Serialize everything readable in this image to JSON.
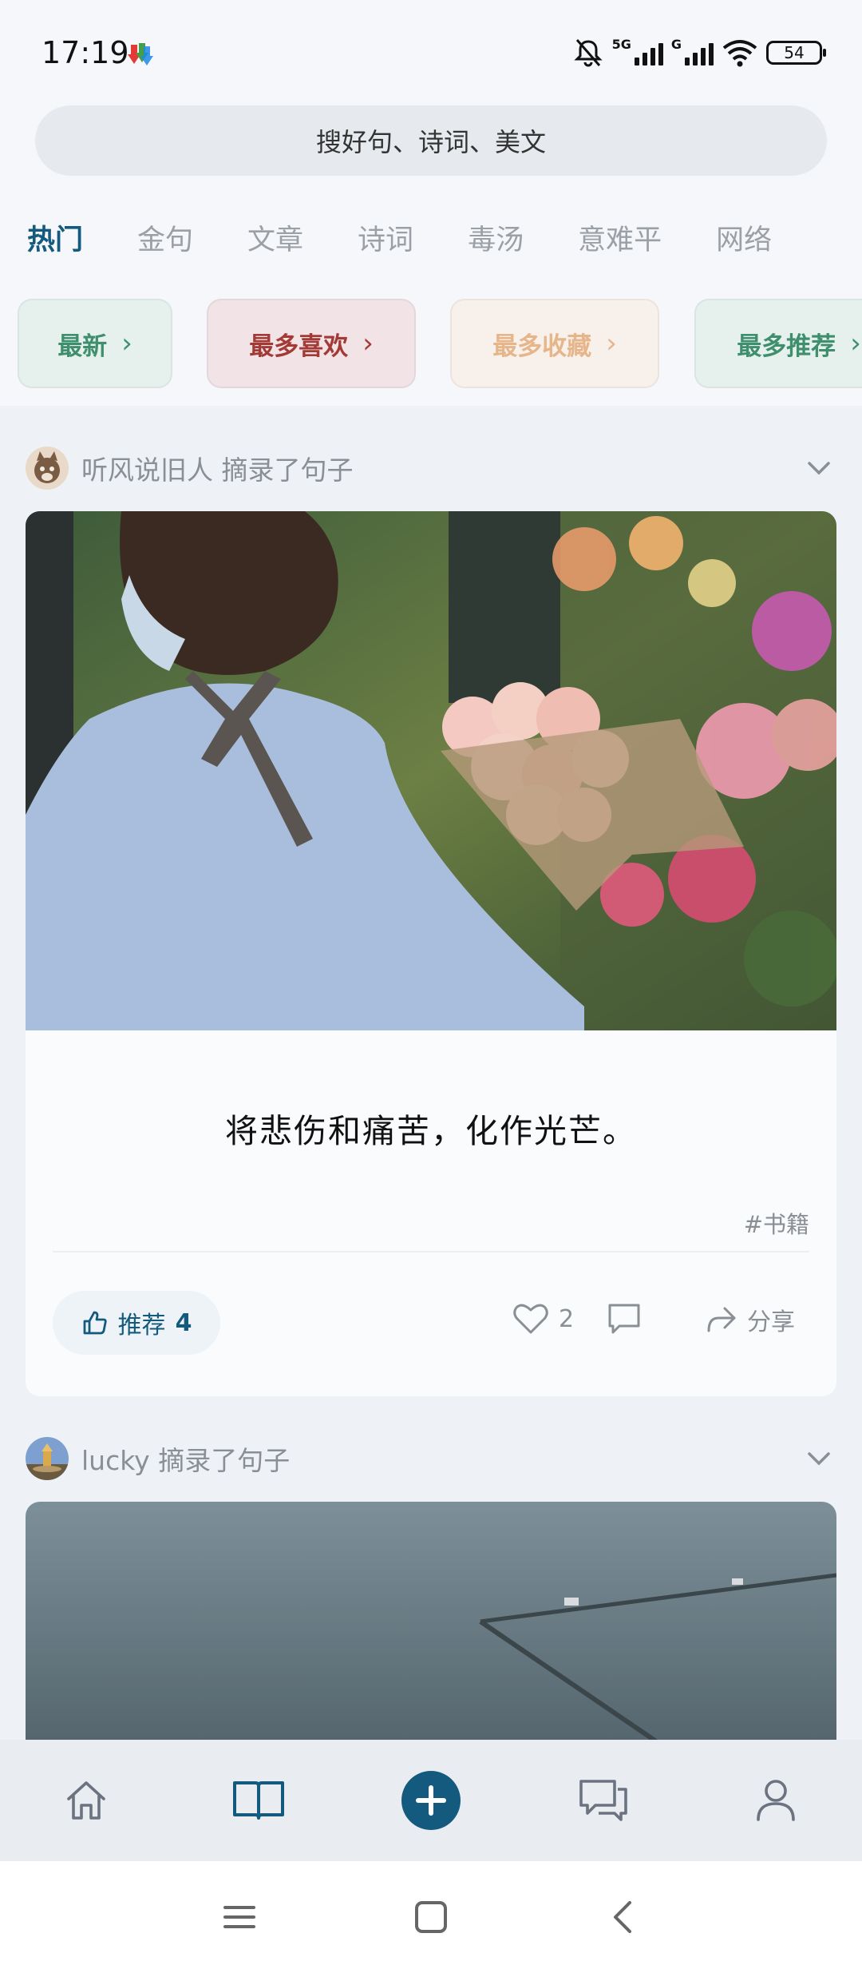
{
  "status_bar": {
    "time": "17:19",
    "network_label_1": "5G",
    "network_label_2": "G",
    "battery": "54"
  },
  "search": {
    "placeholder": "搜好句、诗词、美文"
  },
  "tabs": [
    {
      "label": "热门",
      "active": true
    },
    {
      "label": "金句",
      "active": false
    },
    {
      "label": "文章",
      "active": false
    },
    {
      "label": "诗词",
      "active": false
    },
    {
      "label": "毒汤",
      "active": false
    },
    {
      "label": "意难平",
      "active": false
    },
    {
      "label": "网络",
      "active": false
    }
  ],
  "filters": [
    {
      "label": "最新",
      "color": "#3f8f6e",
      "bg": "#e6f1ee"
    },
    {
      "label": "最多喜欢",
      "color": "#a33a35",
      "bg": "#f1e3e6"
    },
    {
      "label": "最多收藏",
      "color": "#e6b58a",
      "bg": "#f8f0ea"
    },
    {
      "label": "最多推荐",
      "color": "#3f8f6e",
      "bg": "#e6f1ee"
    }
  ],
  "post1": {
    "username": "听风说旧人",
    "action": "摘录了句子",
    "quote": "将悲伤和痛苦，化作光芒。",
    "tag": "#书籍",
    "recommend_label": "推荐",
    "recommend_count": "4",
    "like_count": "2",
    "share_label": "分享"
  },
  "post2": {
    "username": "lucky",
    "action": "摘录了句子"
  },
  "colors": {
    "accent": "#135a7e",
    "muted": "#8a8f95"
  }
}
